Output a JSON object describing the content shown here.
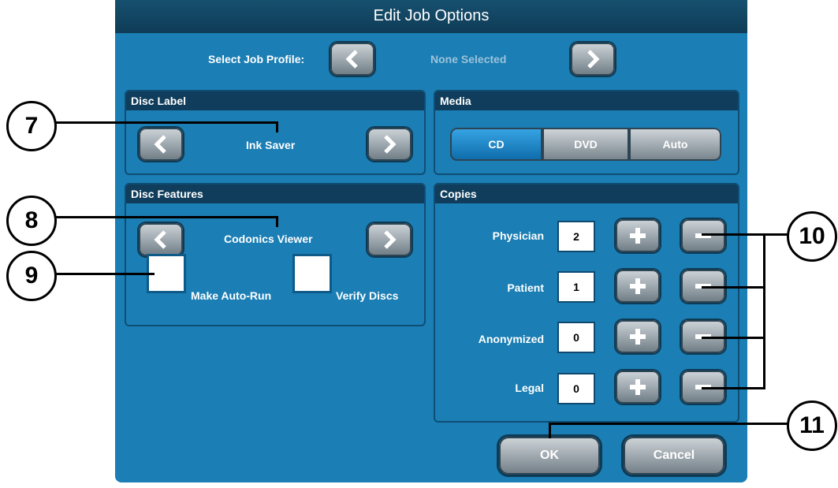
{
  "dialog": {
    "title": "Edit Job Options",
    "profile_label": "Select Job Profile:",
    "profile_value": "None Selected"
  },
  "disc_label": {
    "heading": "Disc Label",
    "value": "Ink Saver"
  },
  "media": {
    "heading": "Media",
    "options": [
      "CD",
      "DVD",
      "Auto"
    ],
    "selected": "CD"
  },
  "disc_features": {
    "heading": "Disc Features",
    "viewer": "Codonics Viewer",
    "auto_run_label": "Make Auto-Run",
    "verify_label": "Verify Discs"
  },
  "copies": {
    "heading": "Copies",
    "rows": [
      {
        "label": "Physician",
        "count": "2"
      },
      {
        "label": "Patient",
        "count": "1"
      },
      {
        "label": "Anonymized",
        "count": "0"
      },
      {
        "label": "Legal",
        "count": "0"
      }
    ]
  },
  "footer": {
    "ok_label": "OK",
    "cancel_label": "Cancel"
  },
  "callouts": [
    "7",
    "8",
    "9",
    "10",
    "11"
  ],
  "colors": {
    "dialog_bg": "#1b7eb4",
    "title_bg": "#0f3c57",
    "active_segment": "#1f8ed0"
  }
}
